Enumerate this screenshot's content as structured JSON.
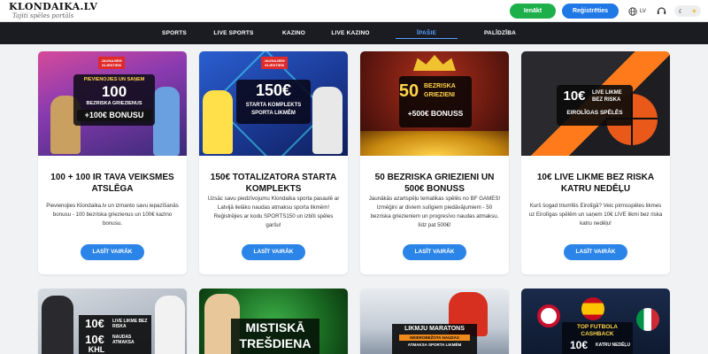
{
  "header": {
    "logo": "KLONDAIKA.LV",
    "logo_tagline": "Tajiti spēles portāls",
    "login_label": "Ienākt",
    "register_label": "Reģistrēties",
    "language": "LV",
    "icons": [
      "globe-icon",
      "headset-icon",
      "moon-icon",
      "sun-icon"
    ]
  },
  "nav": {
    "items": [
      {
        "label": "SPORTS"
      },
      {
        "label": "LIVE SPORTS"
      },
      {
        "label": "KAZINO"
      },
      {
        "label": "LIVE KAZINO"
      },
      {
        "label": "ĪPAŠIE PIEDĀVĀJUMI"
      },
      {
        "label": "PALĪDZĪBA"
      }
    ],
    "active": "ĪPAŠIE PIEDĀVĀJUMI"
  },
  "cards": [
    {
      "banner": {
        "tag": "JAUNAJIEM KLIENTIEM",
        "line1": "PIEVIENOJIES UN SAŅEM",
        "big": "100",
        "line2": "BEZRISKA GRIEZIENUS",
        "line3": "+100€ BONUSU"
      },
      "title": "100 + 100 IR TAVA VEIKSMES ATSLĒGA",
      "text": "Pievienojies Klondaika.lv un izmanto savu iepazīšanās bonusu - 100 bezriska griezienus un 100€ kazino bonusu.",
      "button": "LASĪT VAIRĀK"
    },
    {
      "banner": {
        "tag": "JAUNAJIEM KLIENTIEM",
        "big": "150€",
        "line1": "STARTA KOMPLEKTS",
        "line2": "SPORTA LIKMĒM"
      },
      "title": "150€ TOTALIZATORA STARTA KOMPLEKTS",
      "text": "Uzsāc savu piedzīvojumu Klondaika sporta pasaulē ar Latvijā lielāko naudas atmaksu sporta likmēm! Reģistrējies ar kodu SPORTS150 un izbīti spēles garšu!",
      "button": "LASĪT VAIRĀK"
    },
    {
      "banner": {
        "big": "50",
        "line1": "BEZRISKA",
        "line2": "GRIEZIENI",
        "line3": "+500€ BONUSS"
      },
      "title": "50 BEZRISKA GRIEZIENI UN 500€ BONUSS",
      "text": "Jaunākās azartspēļu tematikas spēlēs no BF GAMES! Izmēģini ar diviem sulīgiem piedāvājumiem - 50 bezriska griezieniem un progresīvo naudas atmaksu, līdz pat 500€!",
      "button": "LASĪT VAIRĀK"
    },
    {
      "banner": {
        "big": "10€",
        "line1": "LIVE LIKME",
        "line2": "BEZ RISKA",
        "line3": "EIROLĪGAS SPĒLĒS"
      },
      "title": "10€ LIVE LIKME BEZ RISKA KATRU NEDĒĻU",
      "text": "Kurš šogad triumfēs Eirolīgā? Veic pirmsspēles likmes uz Eirolīgas spēlēm un saņem 10€ LIVE likmi bez riska katru nedēļu!",
      "button": "LASĪT VAIRĀK"
    }
  ],
  "cards_row2": [
    {
      "banner": {
        "big1": "10€",
        "line1": "LIVE LIKME BEZ RISKA",
        "big2": "10€",
        "line2": "NAUDAS ATMAKSA",
        "league": "KHL"
      }
    },
    {
      "banner": {
        "line1": "MISTISKĀ",
        "line2": "TREŠDIENA"
      }
    },
    {
      "banner": {
        "line1": "LIKMJU MARATONS",
        "line2": "NEIEROBEŽOTA NAUDAS",
        "line3": "ATMAKSA SPORTA LIKMĒM"
      }
    },
    {
      "banner": {
        "line1": "TOP FUTBOLA",
        "line2": "CASHBACK",
        "big": "10€",
        "line3": "KATRU NEDĒĻU"
      }
    }
  ],
  "colors": {
    "nav_bg": "#1a1c22",
    "nav_active": "#5aa0ff",
    "login_green": "#1db04a",
    "primary_blue": "#2b85e8",
    "page_bg": "#f1f2f4"
  }
}
